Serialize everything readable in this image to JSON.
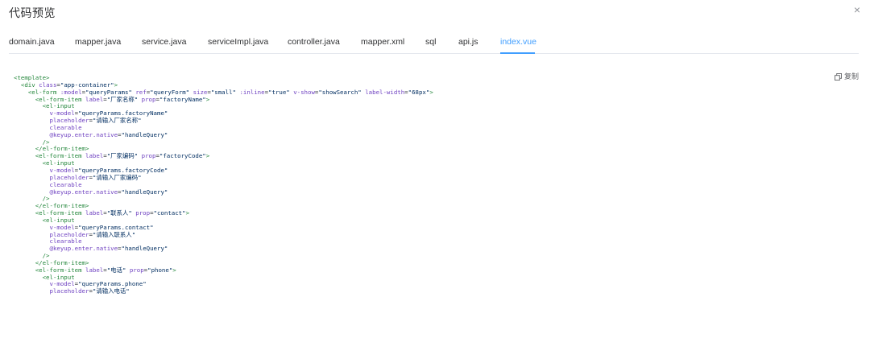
{
  "dialog": {
    "title": "代码预览",
    "close_label": "×"
  },
  "tabs": [
    {
      "label": "domain.java",
      "active": false
    },
    {
      "label": "mapper.java",
      "active": false
    },
    {
      "label": "service.java",
      "active": false
    },
    {
      "label": "serviceImpl.java",
      "active": false
    },
    {
      "label": "controller.java",
      "active": false
    },
    {
      "label": "mapper.xml",
      "active": false
    },
    {
      "label": "sql",
      "active": false
    },
    {
      "label": "api.js",
      "active": false
    },
    {
      "label": "index.vue",
      "active": true
    }
  ],
  "copy_button": {
    "label": "复制",
    "icon": "copy-icon"
  },
  "colors": {
    "accent": "#409eff",
    "tag": "#22863a",
    "attr": "#6f42c1",
    "string": "#032f62"
  },
  "code_lines": [
    [
      [
        "tg",
        "<template>"
      ]
    ],
    [
      [
        "tx",
        "  "
      ],
      [
        "tg",
        "<div"
      ],
      [
        "tx",
        " "
      ],
      [
        "at",
        "class"
      ],
      [
        "tx",
        "="
      ],
      [
        "st",
        "\"app-container\""
      ],
      [
        "tg",
        ">"
      ]
    ],
    [
      [
        "tx",
        "    "
      ],
      [
        "tg",
        "<el-form"
      ],
      [
        "tx",
        " "
      ],
      [
        "at",
        ":model"
      ],
      [
        "tx",
        "="
      ],
      [
        "st",
        "\"queryParams\""
      ],
      [
        "tx",
        " "
      ],
      [
        "at",
        "ref"
      ],
      [
        "tx",
        "="
      ],
      [
        "st",
        "\"queryForm\""
      ],
      [
        "tx",
        " "
      ],
      [
        "at",
        "size"
      ],
      [
        "tx",
        "="
      ],
      [
        "st",
        "\"small\""
      ],
      [
        "tx",
        " "
      ],
      [
        "at",
        ":inline"
      ],
      [
        "tx",
        "="
      ],
      [
        "st",
        "\"true\""
      ],
      [
        "tx",
        " "
      ],
      [
        "at",
        "v-show"
      ],
      [
        "tx",
        "="
      ],
      [
        "st",
        "\"showSearch\""
      ],
      [
        "tx",
        " "
      ],
      [
        "at",
        "label-width"
      ],
      [
        "tx",
        "="
      ],
      [
        "st",
        "\"68px\""
      ],
      [
        "tg",
        ">"
      ]
    ],
    [
      [
        "tx",
        "      "
      ],
      [
        "tg",
        "<el-form-item"
      ],
      [
        "tx",
        " "
      ],
      [
        "at",
        "label"
      ],
      [
        "tx",
        "="
      ],
      [
        "st",
        "\"厂家名称\""
      ],
      [
        "tx",
        " "
      ],
      [
        "at",
        "prop"
      ],
      [
        "tx",
        "="
      ],
      [
        "st",
        "\"factoryName\""
      ],
      [
        "tg",
        ">"
      ]
    ],
    [
      [
        "tx",
        "        "
      ],
      [
        "tg",
        "<el-input"
      ]
    ],
    [
      [
        "tx",
        "          "
      ],
      [
        "at",
        "v-model"
      ],
      [
        "tx",
        "="
      ],
      [
        "st",
        "\"queryParams.factoryName\""
      ]
    ],
    [
      [
        "tx",
        "          "
      ],
      [
        "at",
        "placeholder"
      ],
      [
        "tx",
        "="
      ],
      [
        "st",
        "\"请输入厂家名称\""
      ]
    ],
    [
      [
        "tx",
        "          "
      ],
      [
        "at",
        "clearable"
      ]
    ],
    [
      [
        "tx",
        "          "
      ],
      [
        "at",
        "@keyup.enter.native"
      ],
      [
        "tx",
        "="
      ],
      [
        "st",
        "\"handleQuery\""
      ]
    ],
    [
      [
        "tx",
        "        "
      ],
      [
        "tg",
        "/>"
      ]
    ],
    [
      [
        "tx",
        "      "
      ],
      [
        "tg",
        "</el-form-item>"
      ]
    ],
    [
      [
        "tx",
        "      "
      ],
      [
        "tg",
        "<el-form-item"
      ],
      [
        "tx",
        " "
      ],
      [
        "at",
        "label"
      ],
      [
        "tx",
        "="
      ],
      [
        "st",
        "\"厂家编码\""
      ],
      [
        "tx",
        " "
      ],
      [
        "at",
        "prop"
      ],
      [
        "tx",
        "="
      ],
      [
        "st",
        "\"factoryCode\""
      ],
      [
        "tg",
        ">"
      ]
    ],
    [
      [
        "tx",
        "        "
      ],
      [
        "tg",
        "<el-input"
      ]
    ],
    [
      [
        "tx",
        "          "
      ],
      [
        "at",
        "v-model"
      ],
      [
        "tx",
        "="
      ],
      [
        "st",
        "\"queryParams.factoryCode\""
      ]
    ],
    [
      [
        "tx",
        "          "
      ],
      [
        "at",
        "placeholder"
      ],
      [
        "tx",
        "="
      ],
      [
        "st",
        "\"请输入厂家编码\""
      ]
    ],
    [
      [
        "tx",
        "          "
      ],
      [
        "at",
        "clearable"
      ]
    ],
    [
      [
        "tx",
        "          "
      ],
      [
        "at",
        "@keyup.enter.native"
      ],
      [
        "tx",
        "="
      ],
      [
        "st",
        "\"handleQuery\""
      ]
    ],
    [
      [
        "tx",
        "        "
      ],
      [
        "tg",
        "/>"
      ]
    ],
    [
      [
        "tx",
        "      "
      ],
      [
        "tg",
        "</el-form-item>"
      ]
    ],
    [
      [
        "tx",
        "      "
      ],
      [
        "tg",
        "<el-form-item"
      ],
      [
        "tx",
        " "
      ],
      [
        "at",
        "label"
      ],
      [
        "tx",
        "="
      ],
      [
        "st",
        "\"联系人\""
      ],
      [
        "tx",
        " "
      ],
      [
        "at",
        "prop"
      ],
      [
        "tx",
        "="
      ],
      [
        "st",
        "\"contact\""
      ],
      [
        "tg",
        ">"
      ]
    ],
    [
      [
        "tx",
        "        "
      ],
      [
        "tg",
        "<el-input"
      ]
    ],
    [
      [
        "tx",
        "          "
      ],
      [
        "at",
        "v-model"
      ],
      [
        "tx",
        "="
      ],
      [
        "st",
        "\"queryParams.contact\""
      ]
    ],
    [
      [
        "tx",
        "          "
      ],
      [
        "at",
        "placeholder"
      ],
      [
        "tx",
        "="
      ],
      [
        "st",
        "\"请输入联系人\""
      ]
    ],
    [
      [
        "tx",
        "          "
      ],
      [
        "at",
        "clearable"
      ]
    ],
    [
      [
        "tx",
        "          "
      ],
      [
        "at",
        "@keyup.enter.native"
      ],
      [
        "tx",
        "="
      ],
      [
        "st",
        "\"handleQuery\""
      ]
    ],
    [
      [
        "tx",
        "        "
      ],
      [
        "tg",
        "/>"
      ]
    ],
    [
      [
        "tx",
        "      "
      ],
      [
        "tg",
        "</el-form-item>"
      ]
    ],
    [
      [
        "tx",
        "      "
      ],
      [
        "tg",
        "<el-form-item"
      ],
      [
        "tx",
        " "
      ],
      [
        "at",
        "label"
      ],
      [
        "tx",
        "="
      ],
      [
        "st",
        "\"电话\""
      ],
      [
        "tx",
        " "
      ],
      [
        "at",
        "prop"
      ],
      [
        "tx",
        "="
      ],
      [
        "st",
        "\"phone\""
      ],
      [
        "tg",
        ">"
      ]
    ],
    [
      [
        "tx",
        "        "
      ],
      [
        "tg",
        "<el-input"
      ]
    ],
    [
      [
        "tx",
        "          "
      ],
      [
        "at",
        "v-model"
      ],
      [
        "tx",
        "="
      ],
      [
        "st",
        "\"queryParams.phone\""
      ]
    ],
    [
      [
        "tx",
        "          "
      ],
      [
        "at",
        "placeholder"
      ],
      [
        "tx",
        "="
      ],
      [
        "st",
        "\"请输入电话\""
      ]
    ]
  ]
}
